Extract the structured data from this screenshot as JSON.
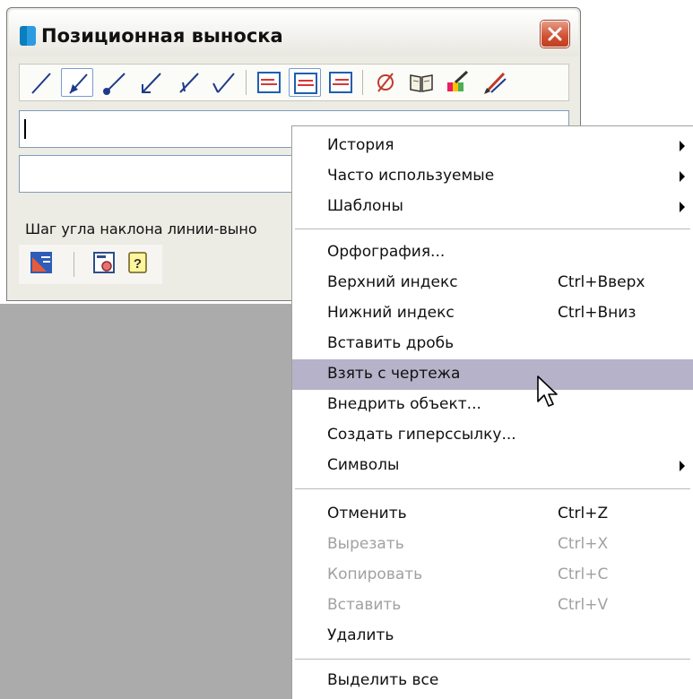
{
  "window": {
    "title": "Позиционная выноска"
  },
  "toolbar": {
    "icons": [
      "line-leader-icon",
      "arrow-leader-icon",
      "dot-leader-icon",
      "open-arrow-leader-icon",
      "tick-leader-icon",
      "check-leader-icon",
      "align-left-icon",
      "align-center-icon",
      "align-right-icon",
      "diameter-icon",
      "book-icon",
      "brush-icon",
      "pen-icon"
    ]
  },
  "fields": {
    "text1": "",
    "text2": ""
  },
  "step_label": "Шаг угла наклона линии-выно",
  "menu": {
    "items": [
      {
        "label": "История",
        "shortcut": "",
        "submenu": true,
        "disabled": false
      },
      {
        "label": "Часто используемые",
        "shortcut": "",
        "submenu": true,
        "disabled": false
      },
      {
        "label": "Шаблоны",
        "shortcut": "",
        "submenu": true,
        "disabled": false
      },
      {
        "label": "Орфография...",
        "shortcut": "",
        "submenu": false,
        "disabled": false
      },
      {
        "label": "Верхний индекс",
        "shortcut": "Ctrl+Вверх",
        "submenu": false,
        "disabled": false
      },
      {
        "label": "Нижний индекс",
        "shortcut": "Ctrl+Вниз",
        "submenu": false,
        "disabled": false
      },
      {
        "label": "Вставить дробь",
        "shortcut": "",
        "submenu": false,
        "disabled": false
      },
      {
        "label": "Взять с чертежа",
        "shortcut": "",
        "submenu": false,
        "disabled": false,
        "highlighted": true
      },
      {
        "label": "Внедрить объект...",
        "shortcut": "",
        "submenu": false,
        "disabled": false
      },
      {
        "label": "Создать гиперссылку...",
        "shortcut": "",
        "submenu": false,
        "disabled": false
      },
      {
        "label": "Символы",
        "shortcut": "",
        "submenu": true,
        "disabled": false
      },
      {
        "label": "Отменить",
        "shortcut": "Ctrl+Z",
        "submenu": false,
        "disabled": false
      },
      {
        "label": "Вырезать",
        "shortcut": "Ctrl+X",
        "submenu": false,
        "disabled": true
      },
      {
        "label": "Копировать",
        "shortcut": "Ctrl+C",
        "submenu": false,
        "disabled": true
      },
      {
        "label": "Вставить",
        "shortcut": "Ctrl+V",
        "submenu": false,
        "disabled": true
      },
      {
        "label": "Удалить",
        "shortcut": "",
        "submenu": false,
        "disabled": false
      },
      {
        "label": "Выделить все",
        "shortcut": "",
        "submenu": false,
        "disabled": false
      }
    ]
  },
  "colors": {
    "highlight": "#b5b2c9",
    "disabled_text": "#a1a1a1",
    "close_button": "#cf5032",
    "desktop": "#ababab"
  }
}
